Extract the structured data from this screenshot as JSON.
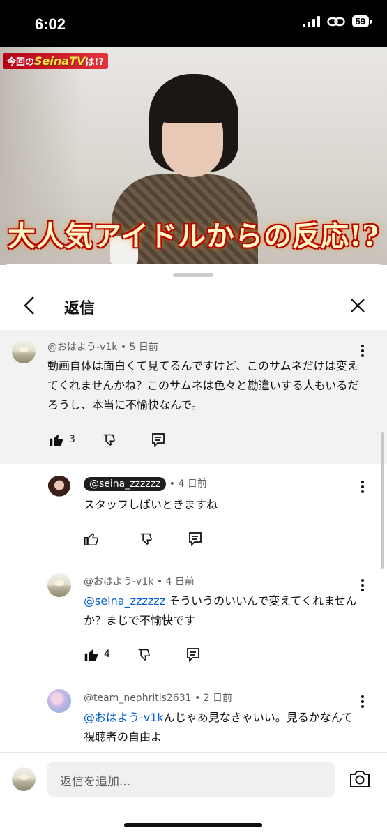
{
  "status_bar": {
    "time": "6:02",
    "battery": "59"
  },
  "video": {
    "banner_prefix": "今回の",
    "banner_brand": "SeinaTV",
    "banner_suffix": "は!?",
    "headline": "大人気アイドルからの反応!?"
  },
  "sheet": {
    "title": "返信"
  },
  "parent_comment": {
    "author": "@おはよう-v1k",
    "time": "5 日前",
    "text": "動画自体は面白くて見てるんですけど、このサムネだけは変えてくれませんかね？このサムネは色々と勘違いする人もいるだろうし、本当に不愉快なんで。",
    "likes": "3"
  },
  "replies": [
    {
      "author": "@seina_zzzzzz",
      "time": "4 日前",
      "text": "スタッフしばいときますね",
      "likes": ""
    },
    {
      "author": "@おはよう-v1k",
      "time": "4 日前",
      "mention": "@seina_zzzzzz",
      "text": "そういうのいいんで変えてくれませんか？まじで不愉快です",
      "likes": "4"
    },
    {
      "author": "@team_nephritis2631",
      "time": "2 日前",
      "mention": "@おはよう-v1k",
      "text": "んじゃあ見なきゃいい。見るかなんて視聴者の自由よ",
      "likes": ""
    }
  ],
  "reply_bar": {
    "placeholder": "返信を追加..."
  },
  "meta_separator": "•",
  "icons": [
    "chevron-left-icon",
    "close-icon",
    "more-vert-icon",
    "thumb-up-icon",
    "thumb-down-icon",
    "reply-icon",
    "camera-icon",
    "signal-icon",
    "link-icon",
    "battery-icon"
  ]
}
